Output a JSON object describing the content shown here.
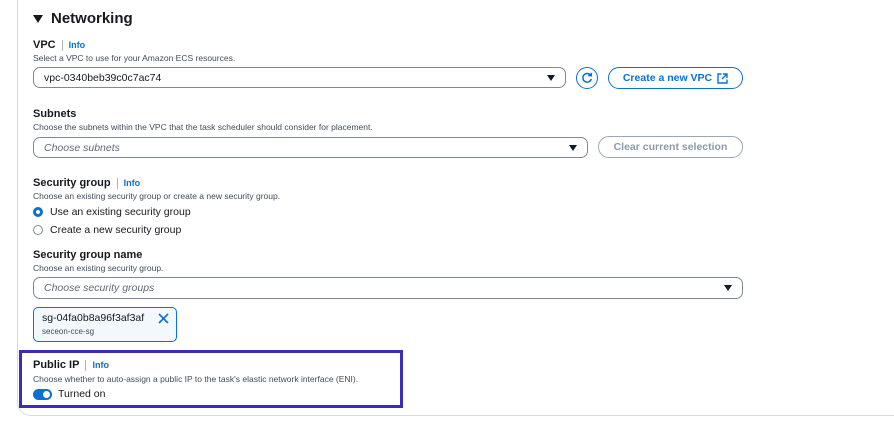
{
  "networking": {
    "title": "Networking",
    "vpc": {
      "label": "VPC",
      "info": "Info",
      "description": "Select a VPC to use for your Amazon ECS resources.",
      "value": "vpc-0340beb39c0c7ac74",
      "create_button": "Create a new VPC"
    },
    "subnets": {
      "label": "Subnets",
      "description": "Choose the subnets within the VPC that the task scheduler should consider for placement.",
      "placeholder": "Choose subnets",
      "clear_button": "Clear current selection"
    },
    "security_group": {
      "label": "Security group",
      "info": "Info",
      "description": "Choose an existing security group or create a new security group.",
      "options": [
        "Use an existing security group",
        "Create a new security group"
      ],
      "selected": "Use an existing security group"
    },
    "security_group_name": {
      "label": "Security group name",
      "description": "Choose an existing security group.",
      "placeholder": "Choose security groups",
      "token": {
        "value": "sg-04fa0b8a96f3af3af",
        "sub": "seceon-cce-sg"
      }
    },
    "public_ip": {
      "label": "Public IP",
      "info": "Info",
      "description": "Choose whether to auto-assign a public IP to the task's elastic network interface (ENI).",
      "toggle_label": "Turned on",
      "enabled": true
    }
  },
  "colors": {
    "accent": "#0972d3",
    "highlight": "#3c2cbe"
  }
}
